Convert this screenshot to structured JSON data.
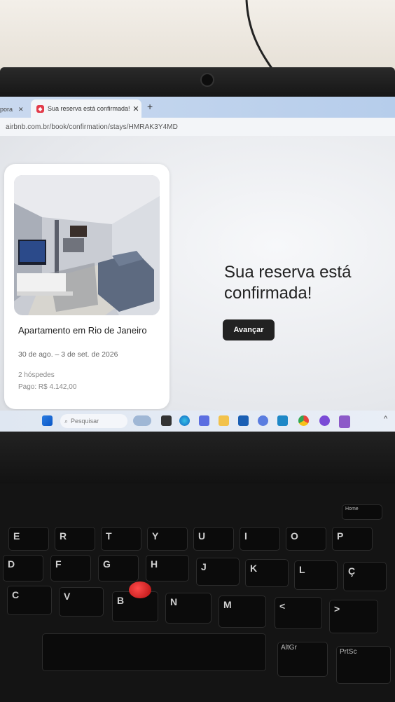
{
  "browser": {
    "prev_tab_label": "pora",
    "active_tab_title": "Sua reserva está confirmada!",
    "close_glyph": "✕",
    "new_tab_glyph": "+",
    "url": "airbnb.com.br/book/confirmation/stays/HMRAK3Y4MD"
  },
  "listing": {
    "title": "Apartamento em Rio de Janeiro",
    "dates": "30 de ago. – 3 de set. de 2026",
    "guests": "2 hóspedes",
    "paid": "Pago: R$ 4.142,00"
  },
  "confirmation": {
    "heading": "Sua reserva está confirmada!",
    "button_label": "Avançar"
  },
  "taskbar": {
    "search_placeholder": "Pesquisar",
    "chevron": "^"
  },
  "keyboard": {
    "row_letters_1": [
      "E",
      "R",
      "T",
      "Y",
      "U",
      "I",
      "O",
      "P"
    ],
    "row_letters_2": [
      "D",
      "F",
      "G",
      "H",
      "J",
      "K",
      "L",
      "Ç"
    ],
    "row_letters_3": [
      "C",
      "V",
      "B",
      "N",
      "M",
      "<",
      ">"
    ],
    "home_label": "Home",
    "altgr_label": "AltGr",
    "prtsc_label": "PrtSc"
  },
  "colors": {
    "airbnb_red": "#e23b4a",
    "button_dark": "#222222",
    "trackpoint_red": "#d11a1a"
  }
}
